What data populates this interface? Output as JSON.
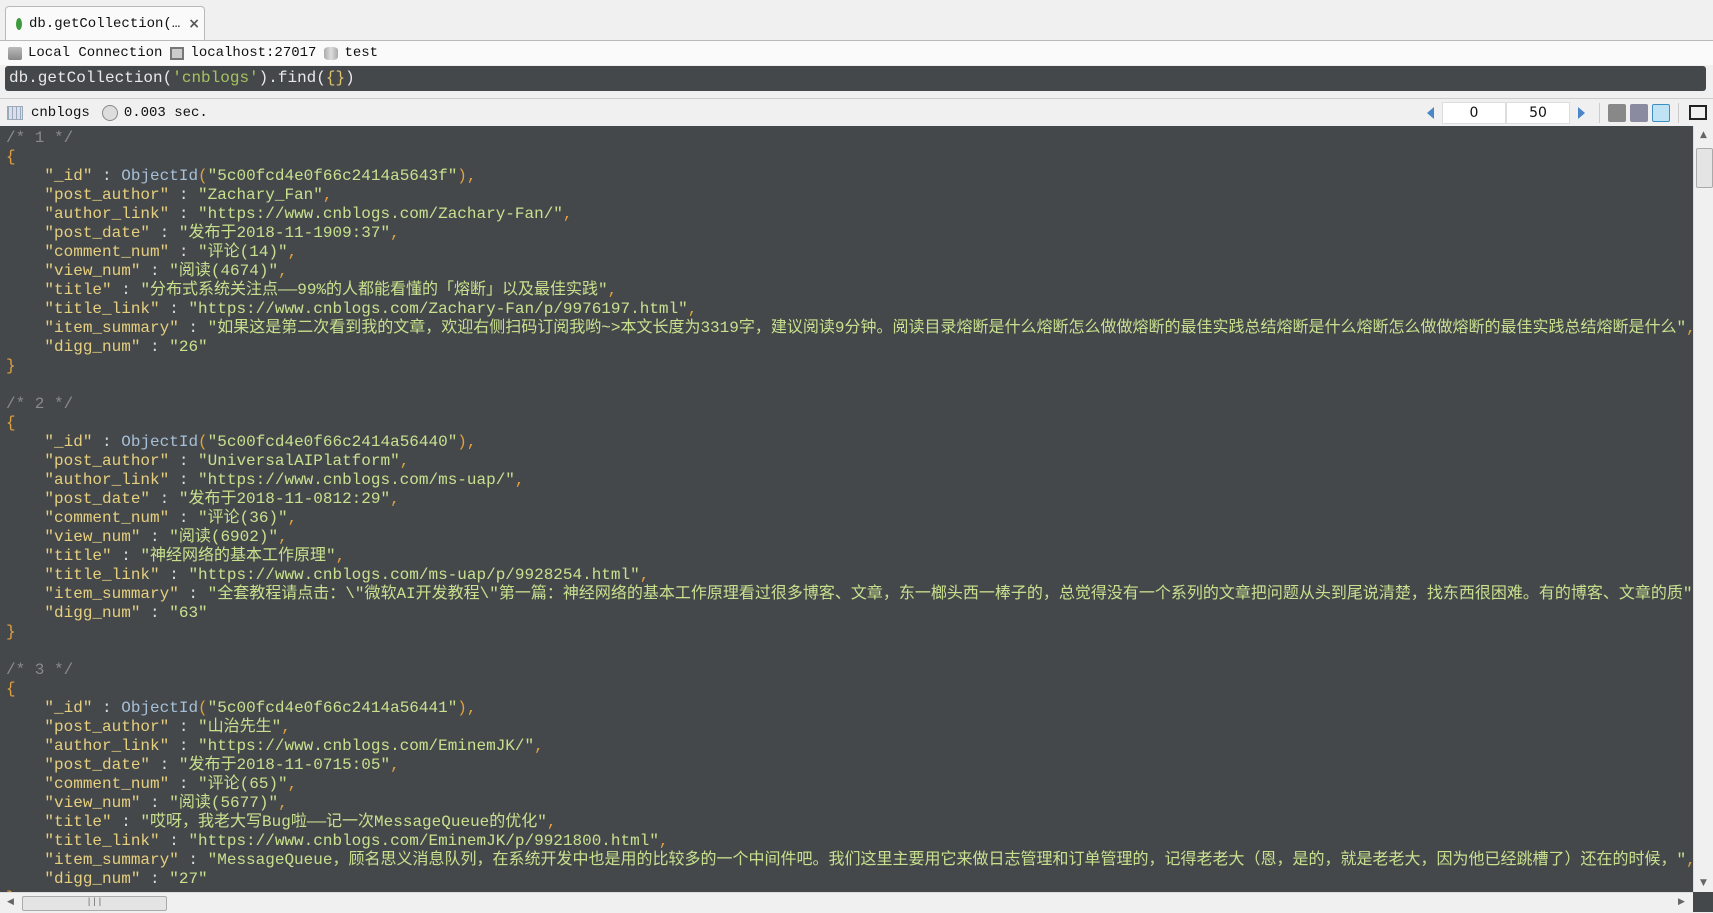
{
  "tab": {
    "title": "db.getCollection(…",
    "icon": "mongodb-leaf-icon",
    "close": "×"
  },
  "connection": {
    "name": "Local Connection",
    "host": "localhost:27017",
    "database": "test"
  },
  "query": {
    "prefix": "db.getCollection(",
    "collection": "'cnblogs'",
    "suffix": ").find(",
    "args": "{}",
    "end": ")"
  },
  "results": {
    "collection": "cnblogs",
    "time": "0.003 sec.",
    "skip": "0",
    "limit": "50",
    "active_view": "text"
  },
  "colors": {
    "editor_bg": "#45484b",
    "key": "#e6cf7e",
    "value": "#c8e08e",
    "comment": "#8a8a8a",
    "brace": "#e0a040"
  },
  "documents": [
    {
      "num": "1",
      "fields": [
        [
          "_id",
          "ObjectId",
          "5c00fcd4e0f66c2414a5643f"
        ],
        [
          "post_author",
          "Zachary_Fan"
        ],
        [
          "author_link",
          "https://www.cnblogs.com/Zachary-Fan/"
        ],
        [
          "post_date",
          "发布于2018-11-1909:37"
        ],
        [
          "comment_num",
          "评论(14)"
        ],
        [
          "view_num",
          "阅读(4674)"
        ],
        [
          "title",
          "分布式系统关注点——99%的人都能看懂的「熔断」以及最佳实践"
        ],
        [
          "title_link",
          "https://www.cnblogs.com/Zachary-Fan/p/9976197.html"
        ],
        [
          "item_summary",
          "如果这是第二次看到我的文章，欢迎右侧扫码订阅我哟~>本文长度为3319字，建议阅读9分钟。阅读目录熔断是什么熔断怎么做做熔断的最佳实践总结熔断是什么熔断怎么做做熔断的最佳实践总结熔断是什么"
        ],
        [
          "digg_num",
          "26"
        ]
      ]
    },
    {
      "num": "2",
      "fields": [
        [
          "_id",
          "ObjectId",
          "5c00fcd4e0f66c2414a56440"
        ],
        [
          "post_author",
          "UniversalAIPlatform"
        ],
        [
          "author_link",
          "https://www.cnblogs.com/ms-uap/"
        ],
        [
          "post_date",
          "发布于2018-11-0812:29"
        ],
        [
          "comment_num",
          "评论(36)"
        ],
        [
          "view_num",
          "阅读(6902)"
        ],
        [
          "title",
          "神经网络的基本工作原理"
        ],
        [
          "title_link",
          "https://www.cnblogs.com/ms-uap/p/9928254.html"
        ],
        [
          "item_summary",
          "全套教程请点击：\\\"微软AI开发教程\\\"第一篇：神经网络的基本工作原理看过很多博客、文章，东一榔头西一棒子的，总觉得没有一个系列的文章把问题从头到尾说清楚，找东西很困难。有的博客、文章的质"
        ],
        [
          "digg_num",
          "63"
        ]
      ]
    },
    {
      "num": "3",
      "fields": [
        [
          "_id",
          "ObjectId",
          "5c00fcd4e0f66c2414a56441"
        ],
        [
          "post_author",
          "山治先生"
        ],
        [
          "author_link",
          "https://www.cnblogs.com/EminemJK/"
        ],
        [
          "post_date",
          "发布于2018-11-0715:05"
        ],
        [
          "comment_num",
          "评论(65)"
        ],
        [
          "view_num",
          "阅读(5677)"
        ],
        [
          "title",
          "哎呀，我老大写Bug啦——记一次MessageQueue的优化"
        ],
        [
          "title_link",
          "https://www.cnblogs.com/EminemJK/p/9921800.html"
        ],
        [
          "item_summary",
          "MessageQueue，顾名思义消息队列，在系统开发中也是用的比较多的一个中间件吧。我们这里主要用它来做日志管理和订单管理的，记得老老大（恩，是的，就是老老大，因为他已经跳槽了）还在的时候，"
        ],
        [
          "digg_num",
          "27"
        ]
      ]
    }
  ]
}
